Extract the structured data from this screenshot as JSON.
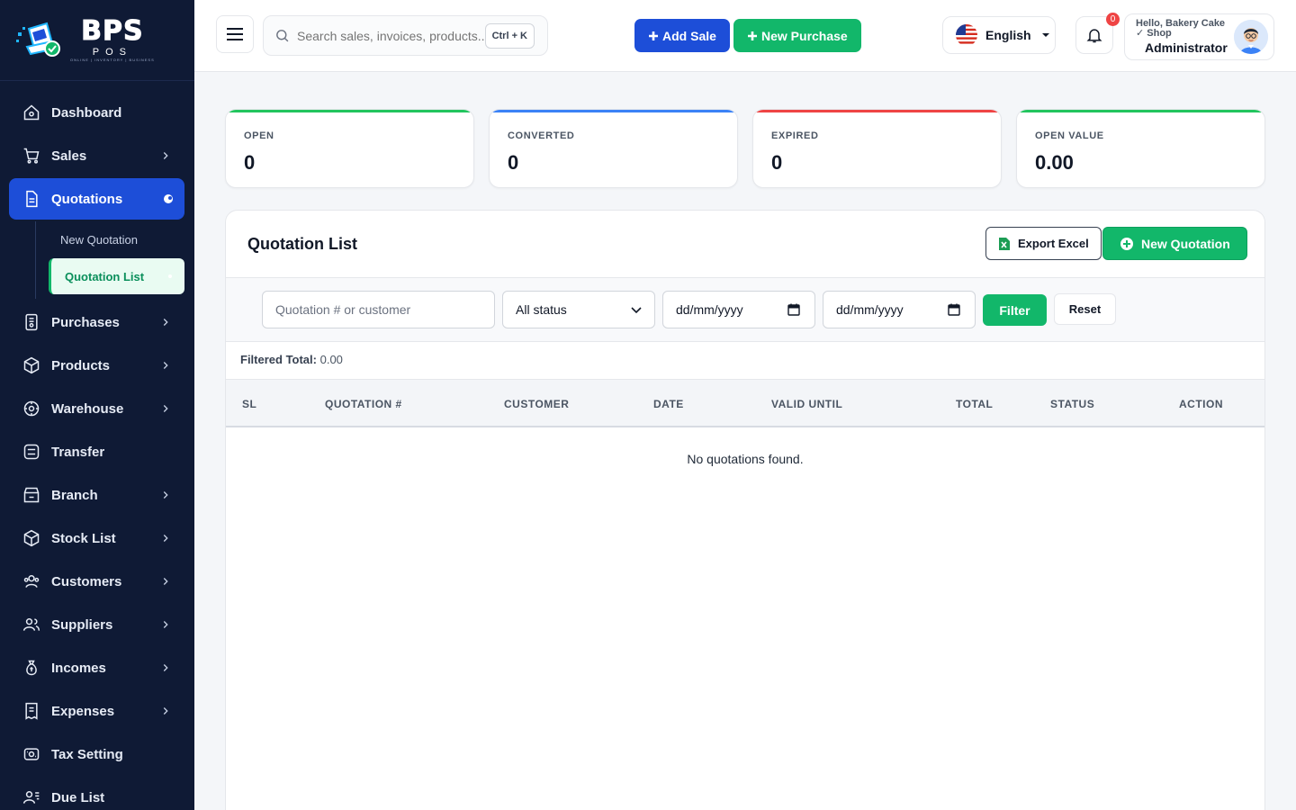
{
  "brand": {
    "name": "BPS",
    "sub": "POS",
    "tagline": "ONLINE | INVENTORY | BUSINESS"
  },
  "sidebar": {
    "items": [
      {
        "label": "Dashboard",
        "icon": "home-icon",
        "chevron": false
      },
      {
        "label": "Sales",
        "icon": "cart-icon",
        "chevron": true
      },
      {
        "label": "Quotations",
        "icon": "document-icon",
        "chevron": false,
        "active": true
      },
      {
        "label": "Purchases",
        "icon": "receipt-icon",
        "chevron": true
      },
      {
        "label": "Products",
        "icon": "box-icon",
        "chevron": true
      },
      {
        "label": "Warehouse",
        "icon": "warehouse-icon",
        "chevron": true
      },
      {
        "label": "Transfer",
        "icon": "transfer-icon",
        "chevron": false
      },
      {
        "label": "Branch",
        "icon": "store-icon",
        "chevron": true
      },
      {
        "label": "Stock List",
        "icon": "cube-icon",
        "chevron": true
      },
      {
        "label": "Customers",
        "icon": "users-icon",
        "chevron": true
      },
      {
        "label": "Suppliers",
        "icon": "user-group-icon",
        "chevron": true
      },
      {
        "label": "Incomes",
        "icon": "money-bag-icon",
        "chevron": true
      },
      {
        "label": "Expenses",
        "icon": "bill-icon",
        "chevron": true
      },
      {
        "label": "Tax Setting",
        "icon": "tax-icon",
        "chevron": false
      },
      {
        "label": "Due List",
        "icon": "user-list-icon",
        "chevron": false
      }
    ],
    "quotation_sub": [
      {
        "label": "New Quotation"
      },
      {
        "label": "Quotation List",
        "active": true
      }
    ]
  },
  "header": {
    "search_placeholder": "Search sales, invoices, products...",
    "shortcut": "Ctrl + K",
    "add_sale": "Add Sale",
    "new_purchase": "New Purchase",
    "language": "English",
    "notification_count": "0",
    "greeting": "Hello, Bakery Cake ✓ Shop",
    "role": "Administrator"
  },
  "stats": [
    {
      "label": "OPEN",
      "value": "0",
      "color": "#22c55e"
    },
    {
      "label": "CONVERTED",
      "value": "0",
      "color": "#3b82f6"
    },
    {
      "label": "EXPIRED",
      "value": "0",
      "color": "#ef4444"
    },
    {
      "label": "OPEN VALUE",
      "value": "0.00",
      "color": "#22c55e"
    }
  ],
  "panel": {
    "title": "Quotation List",
    "export": "Export Excel",
    "new_quotation": "New Quotation",
    "filters": {
      "search_placeholder": "Quotation # or customer",
      "status": "All status",
      "date_from": "dd/mm/yyyy",
      "date_to": "dd/mm/yyyy",
      "filter": "Filter",
      "reset": "Reset"
    },
    "filtered_total_label": "Filtered Total:",
    "filtered_total_value": "0.00",
    "columns": [
      "SL",
      "QUOTATION #",
      "CUSTOMER",
      "DATE",
      "VALID UNTIL",
      "TOTAL",
      "STATUS",
      "ACTION"
    ],
    "empty_message": "No quotations found."
  },
  "colors": {
    "sidebar_bg": "#0f1a35",
    "primary": "#1d4ed8",
    "success": "#12b76a"
  }
}
